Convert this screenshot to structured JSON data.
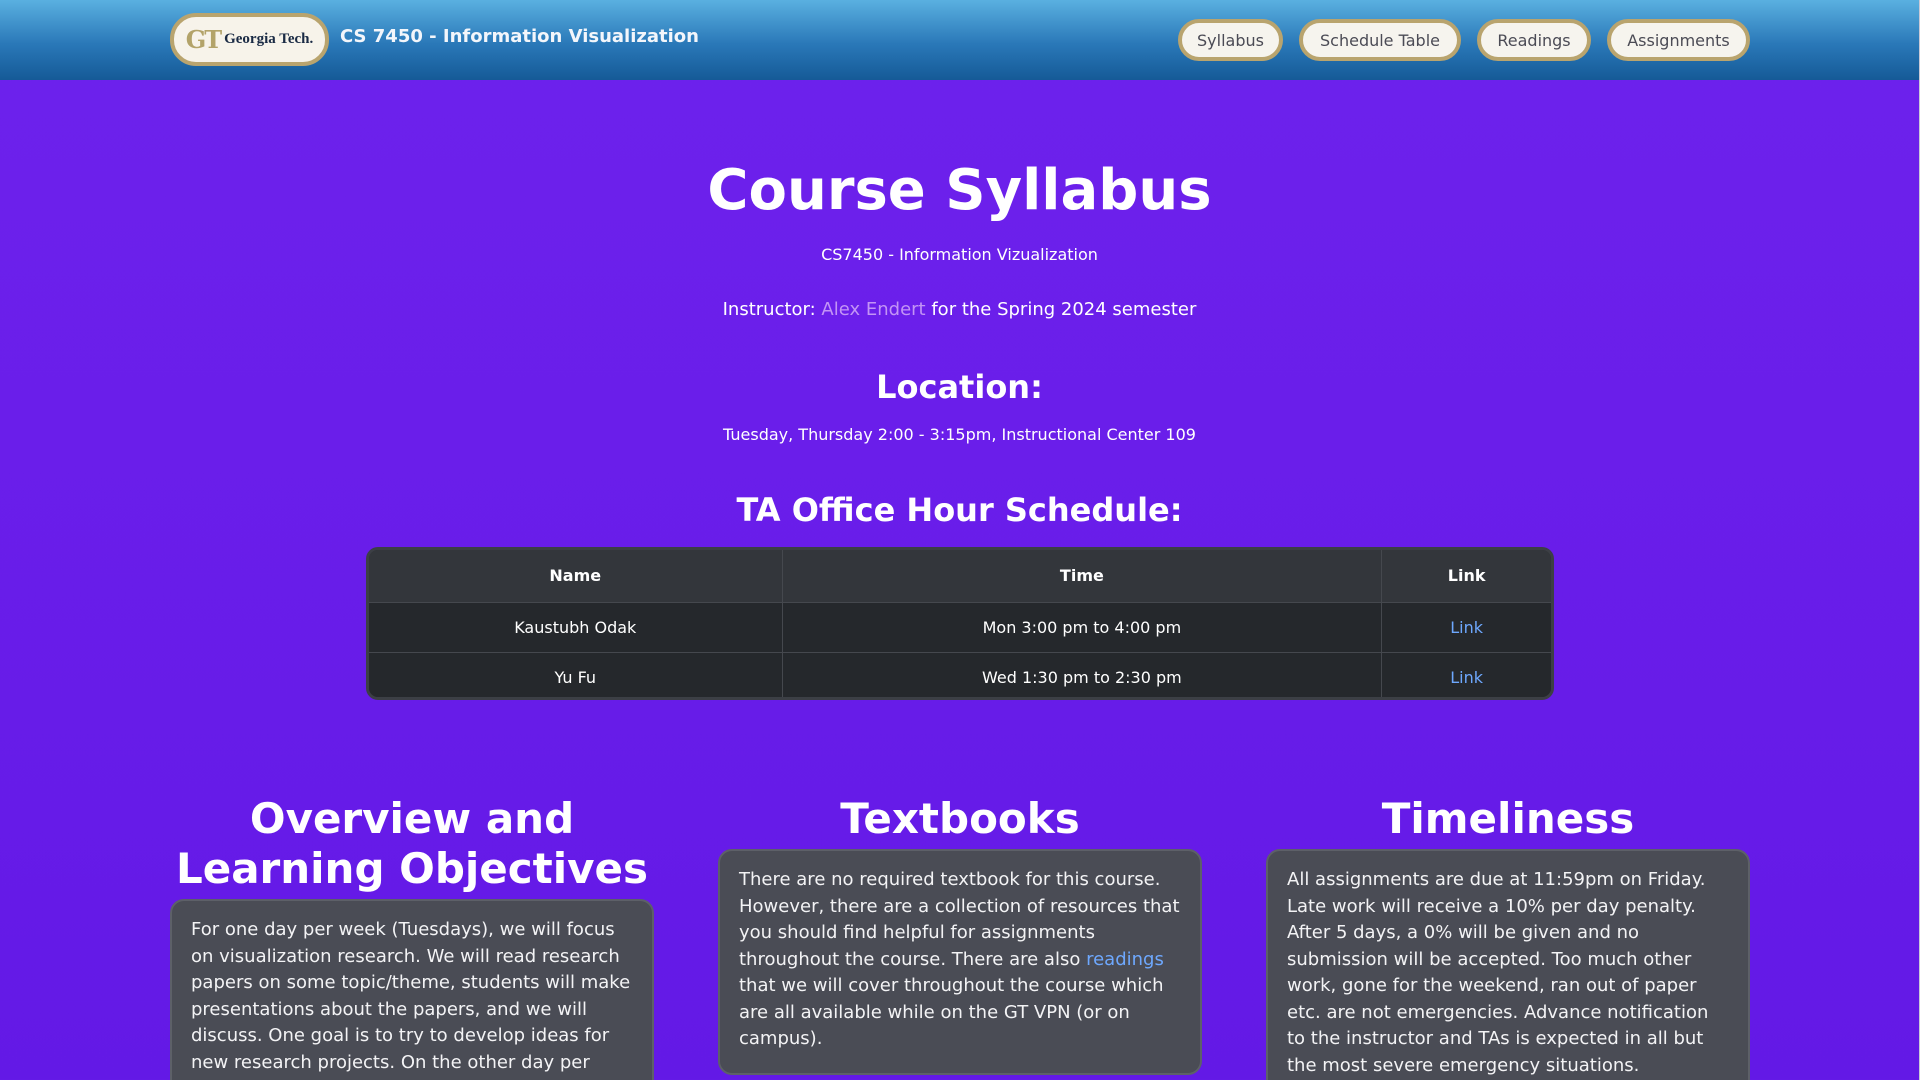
{
  "header": {
    "logo_mark": "GT",
    "logo_text": "Georgia Tech.",
    "site_title": "CS 7450 - Information Visualization",
    "nav": [
      "Syllabus",
      "Schedule Table",
      "Readings",
      "Assignments"
    ]
  },
  "main": {
    "title": "Course Syllabus",
    "subtitle": "CS7450 - Information Vizualization",
    "instructor_prefix": "Instructor:",
    "instructor_name": "Alex Endert",
    "instructor_suffix": "for the Spring 2024 semester",
    "location_title": "Location:",
    "location_text": "Tuesday, Thursday 2:00 - 3:15pm, Instructional Center 109",
    "ta_title": "TA Office Hour Schedule:"
  },
  "ta_table": {
    "headers": [
      "Name",
      "Time",
      "Link"
    ],
    "rows": [
      {
        "name": "Kaustubh Odak",
        "time": "Mon 3:00 pm to 4:00 pm",
        "link": "Link"
      },
      {
        "name": "Yu Fu",
        "time": "Wed 1:30 pm to 2:30 pm",
        "link": "Link"
      }
    ]
  },
  "columns": {
    "overview": {
      "title": "Overview and Learning Objectives",
      "text": "For one day per week (Tuesdays), we will focus on visualization research. We will read research papers on some topic/theme, students will make presentations about the papers, and we will discuss. One goal is to try to develop ideas for new research projects. On the other day per week"
    },
    "textbooks": {
      "title": "Textbooks",
      "text_before": "There are no required textbook for this course. However, there are a collection of resources that you should find helpful for assignments throughout the course. There are also",
      "link": "readings",
      "text_after": "that we will cover throughout the course which are all available while on the GT VPN (or on campus)."
    },
    "timeliness": {
      "title": "Timeliness",
      "text": "All assignments are due at 11:59pm on Friday. Late work will receive a 10% per day penalty. After 5 days, a 0% will be given and no submission will be accepted. Too much other work, gone for the weekend, ran out of paper etc. are not emergencies. Advance notification to the instructor and TAs is expected in all but the most severe emergency situations."
    }
  },
  "colors": {
    "background": "#6a1eea",
    "header_gradient_top": "#5ab0e0",
    "header_gradient_bottom": "#155a97",
    "gold_border": "#b9a46e",
    "card_bg": "#4a4c55",
    "table_bg": "#2c2f33",
    "link_blue": "#6ea8fe",
    "link_purple": "#c394f5"
  }
}
